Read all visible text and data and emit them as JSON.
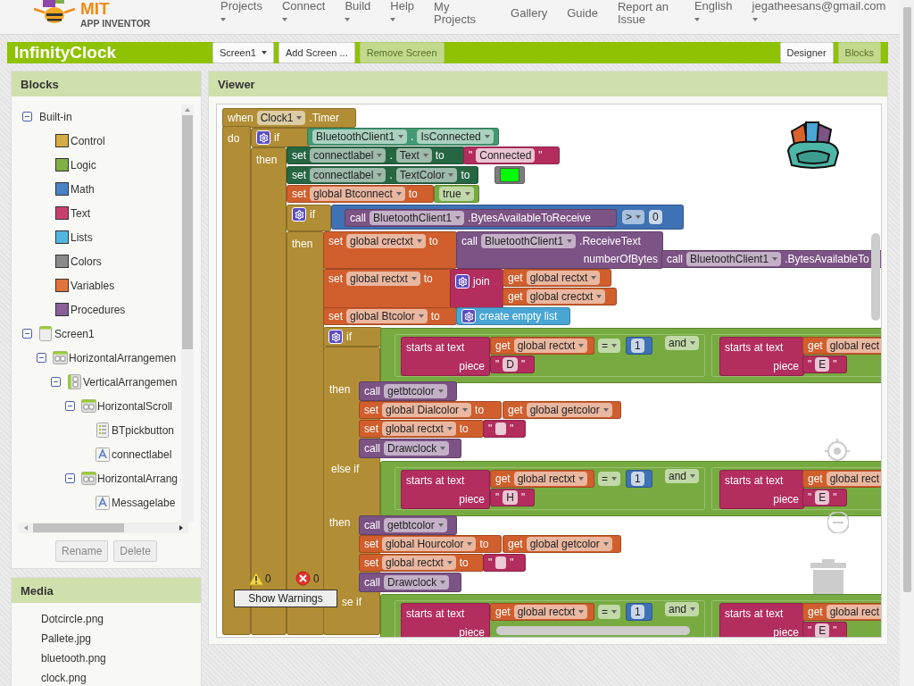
{
  "app": {
    "logo": {
      "title": "MIT",
      "subtitle": "APP INVENTOR"
    },
    "nav": [
      {
        "label": "Projects",
        "menu": true
      },
      {
        "label": "Connect",
        "menu": true
      },
      {
        "label": "Build",
        "menu": true
      },
      {
        "label": "Help",
        "menu": true
      },
      {
        "label": "My Projects",
        "menu": false
      },
      {
        "label": "Gallery",
        "menu": false
      },
      {
        "label": "Guide",
        "menu": false
      },
      {
        "label": "Report an Issue",
        "menu": false
      },
      {
        "label": "English",
        "menu": true
      },
      {
        "label": "jegatheesans@gmail.com",
        "menu": true
      }
    ]
  },
  "toolbar": {
    "project": "InfinityClock",
    "screen": "Screen1",
    "actions": [
      {
        "label": "Add Screen ...",
        "disabled": false
      },
      {
        "label": "Remove Screen",
        "disabled": true
      }
    ],
    "views": [
      {
        "label": "Designer",
        "selected": false
      },
      {
        "label": "Blocks",
        "selected": true
      }
    ]
  },
  "blocks_panel": {
    "title": "Blocks",
    "tree": [
      {
        "label": "Built-in",
        "kind": "group",
        "expanded": true,
        "children": [
          {
            "label": "Control",
            "kind": "category",
            "color": "#d6ac45"
          },
          {
            "label": "Logic",
            "kind": "category",
            "color": "#7fb045"
          },
          {
            "label": "Math",
            "kind": "category",
            "color": "#4a80c4"
          },
          {
            "label": "Text",
            "kind": "category",
            "color": "#c8416e"
          },
          {
            "label": "Lists",
            "kind": "category",
            "color": "#52b7e0"
          },
          {
            "label": "Colors",
            "kind": "category",
            "color": "#8a8a8a"
          },
          {
            "label": "Variables",
            "kind": "category",
            "color": "#e0743a"
          },
          {
            "label": "Procedures",
            "kind": "category",
            "color": "#8a5e98"
          }
        ]
      },
      {
        "label": "Screen1",
        "kind": "screen",
        "expanded": true,
        "children": [
          {
            "label": "HorizontalArrangemen",
            "kind": "arrangement",
            "expanded": true,
            "children": [
              {
                "label": "VerticalArrangemen",
                "kind": "vertical",
                "expanded": true,
                "children": [
                  {
                    "label": "HorizontalScroll",
                    "kind": "arrangement",
                    "expanded": true,
                    "children": [
                      {
                        "label": "BTpickbutton",
                        "kind": "listpicker"
                      },
                      {
                        "label": "connectlabel",
                        "kind": "label"
                      }
                    ]
                  },
                  {
                    "label": "HorizontalArrang",
                    "kind": "arrangement",
                    "expanded": true,
                    "children": [
                      {
                        "label": "Messagelabe",
                        "kind": "label"
                      }
                    ]
                  }
                ]
              }
            ]
          }
        ]
      }
    ],
    "buttons": [
      {
        "label": "Rename",
        "disabled": true
      },
      {
        "label": "Delete",
        "disabled": true
      }
    ]
  },
  "media": {
    "title": "Media",
    "files": [
      "Dotcircle.png",
      "Pallete.jpg",
      "bluetooth.png",
      "clock.png"
    ]
  },
  "viewer": {
    "title": "Viewer",
    "blocks": [
      {
        "kind": "block",
        "color": "#b18e35",
        "lines": [
          [
            {
              "kind": "label",
              "text": "when"
            },
            {
              "kind": "dropdown",
              "text": "Clock1"
            },
            {
              "kind": "label",
              "text": ".Timer"
            }
          ]
        ]
      },
      {
        "kind": "block",
        "color": "#b18e35",
        "lines": [
          [
            {
              "kind": "label",
              "text": "do"
            }
          ]
        ]
      },
      {
        "kind": "block",
        "color": "#b18e35",
        "lines": [
          [
            {
              "kind": "gear"
            },
            {
              "kind": "label",
              "text": "if"
            }
          ]
        ]
      },
      {
        "kind": "block",
        "color": "#b18e35",
        "lines": [
          [
            {
              "kind": "label",
              "text": "then"
            }
          ]
        ]
      },
      {
        "kind": "block",
        "color": "#439a72",
        "lines": [
          [
            {
              "kind": "dropdown",
              "text": "BluetoothClient1"
            },
            {
              "kind": "label",
              "text": "."
            },
            {
              "kind": "dropdown",
              "text": "IsConnected"
            }
          ]
        ]
      },
      {
        "kind": "block",
        "color": "#266643",
        "lines": [
          [
            {
              "kind": "label",
              "text": "set"
            },
            {
              "kind": "dropdown",
              "text": "connectlabel"
            },
            {
              "kind": "label",
              "text": "."
            },
            {
              "kind": "dropdown",
              "text": "Text"
            },
            {
              "kind": "label",
              "text": "to"
            }
          ]
        ]
      },
      {
        "kind": "block",
        "color": "#b32d5e",
        "lines": [
          [
            {
              "kind": "label",
              "text": "\""
            },
            {
              "kind": "value",
              "text": "Connected"
            },
            {
              "kind": "label",
              "text": "\""
            }
          ]
        ]
      },
      {
        "kind": "block",
        "color": "#266643",
        "lines": [
          [
            {
              "kind": "label",
              "text": "set"
            },
            {
              "kind": "dropdown",
              "text": "connectlabel"
            },
            {
              "kind": "label",
              "text": "."
            },
            {
              "kind": "dropdown",
              "text": "TextColor"
            },
            {
              "kind": "label",
              "text": "to"
            }
          ]
        ]
      },
      {
        "kind": "block",
        "color": "#7d7d7d",
        "lines": [
          [
            {
              "kind": "swatch",
              "color": "#00ff00"
            }
          ]
        ]
      },
      {
        "kind": "block",
        "color": "#d05f2d",
        "lines": [
          [
            {
              "kind": "label",
              "text": "set"
            },
            {
              "kind": "dropdown",
              "text": "global Btconnect"
            },
            {
              "kind": "label",
              "text": "to"
            }
          ]
        ]
      },
      {
        "kind": "block",
        "color": "#77ab41",
        "lines": [
          [
            {
              "kind": "dropdown",
              "text": "true"
            }
          ]
        ]
      },
      {
        "kind": "block",
        "color": "#b18e35",
        "lines": [
          [
            {
              "kind": "gear"
            },
            {
              "kind": "label",
              "text": "if"
            }
          ]
        ]
      },
      {
        "kind": "block",
        "color": "#b18e35",
        "lines": [
          [
            {
              "kind": "label",
              "text": "then"
            }
          ]
        ]
      },
      {
        "kind": "block",
        "color": "#3f71b5"
      },
      {
        "kind": "block",
        "color": "#7c5385",
        "lines": [
          [
            {
              "kind": "label",
              "text": "call"
            },
            {
              "kind": "dropdown",
              "text": "BluetoothClient1"
            },
            {
              "kind": "label",
              "text": ".BytesAvailableToReceive"
            }
          ]
        ]
      },
      {
        "kind": "fields",
        "lines": [
          [
            {
              "kind": "dropdown",
              "text": ">"
            },
            {
              "kind": "value",
              "text": "0"
            }
          ]
        ]
      },
      {
        "kind": "block",
        "color": "#d05f2d",
        "lines": [
          [
            {
              "kind": "label",
              "text": "set"
            },
            {
              "kind": "dropdown",
              "text": "global crectxt"
            },
            {
              "kind": "label",
              "text": "to"
            }
          ]
        ]
      },
      {
        "kind": "block",
        "color": "#7c5385",
        "lines": [
          [
            {
              "kind": "label",
              "text": "call"
            },
            {
              "kind": "dropdown",
              "text": "BluetoothClient1"
            },
            {
              "kind": "label",
              "text": ".ReceiveText"
            }
          ],
          [
            {
              "kind": "label",
              "text": "numberOfBytes"
            }
          ]
        ]
      },
      {
        "kind": "block",
        "color": "#7c5385",
        "lines": [
          [
            {
              "kind": "label",
              "text": "call"
            },
            {
              "kind": "dropdown",
              "text": "BluetoothClient1"
            },
            {
              "kind": "label",
              "text": ".BytesAvailableTo"
            }
          ]
        ]
      },
      {
        "kind": "block",
        "color": "#d05f2d",
        "lines": [
          [
            {
              "kind": "label",
              "text": "set"
            },
            {
              "kind": "dropdown",
              "text": "global rectxt"
            },
            {
              "kind": "label",
              "text": "to"
            }
          ]
        ]
      },
      {
        "kind": "block",
        "color": "#b32d5e",
        "lines": [
          [
            {
              "kind": "gear"
            },
            {
              "kind": "label",
              "text": "join"
            }
          ]
        ]
      },
      {
        "kind": "block",
        "color": "#d05f2d",
        "lines": [
          [
            {
              "kind": "label",
              "text": "get"
            },
            {
              "kind": "dropdown",
              "text": "global rectxt"
            }
          ]
        ]
      },
      {
        "kind": "block",
        "color": "#d05f2d",
        "lines": [
          [
            {
              "kind": "label",
              "text": "get"
            },
            {
              "kind": "dropdown",
              "text": "global crectxt"
            }
          ]
        ]
      },
      {
        "kind": "block",
        "color": "#d05f2d",
        "lines": [
          [
            {
              "kind": "label",
              "text": "set"
            },
            {
              "kind": "dropdown",
              "text": "global Btcolor"
            },
            {
              "kind": "label",
              "text": "to"
            }
          ]
        ]
      },
      {
        "kind": "block",
        "color": "#49a6d4",
        "lines": [
          [
            {
              "kind": "gear"
            },
            {
              "kind": "label",
              "text": "create empty list"
            }
          ]
        ]
      },
      {
        "kind": "block",
        "color": "#b18e35",
        "lines": [
          [
            {
              "kind": "gear"
            },
            {
              "kind": "label",
              "text": "if"
            }
          ]
        ]
      },
      {
        "kind": "block",
        "color": "#b18e35"
      },
      {
        "kind": "label",
        "text": "then"
      },
      {
        "kind": "label",
        "text": "else if"
      },
      {
        "kind": "label",
        "text": "then"
      },
      {
        "kind": "label",
        "text": "se if"
      },
      {
        "kind": "block",
        "color": "#77ab41"
      },
      {
        "kind": "socket",
        "color": "#77ab41"
      },
      {
        "kind": "block",
        "color": "#b32d5e",
        "lines": [
          [
            {
              "kind": "label",
              "text": "starts at text"
            }
          ],
          [
            {
              "kind": "label",
              "text": "piece"
            }
          ]
        ]
      },
      {
        "kind": "block",
        "color": "#d05f2d",
        "lines": [
          [
            {
              "kind": "label",
              "text": "get"
            },
            {
              "kind": "dropdown",
              "text": "global rectxt"
            }
          ]
        ]
      },
      {
        "kind": "fields",
        "lines": [
          [
            {
              "kind": "dropdown",
              "text": "="
            }
          ]
        ]
      },
      {
        "kind": "block",
        "color": "#3f71b5",
        "lines": [
          [
            {
              "kind": "value",
              "text": "1"
            }
          ]
        ]
      },
      {
        "kind": "block",
        "color": "#b32d5e",
        "lines": [
          [
            {
              "kind": "label",
              "text": "\""
            },
            {
              "kind": "value",
              "text": "D"
            },
            {
              "kind": "label",
              "text": "\""
            }
          ]
        ]
      },
      {
        "kind": "fields",
        "lines": [
          [
            {
              "kind": "dropdown",
              "text": "and"
            }
          ]
        ]
      },
      {
        "kind": "socket",
        "color": "#77ab41"
      },
      {
        "kind": "block",
        "color": "#b32d5e",
        "lines": [
          [
            {
              "kind": "label",
              "text": "starts at text"
            }
          ],
          [
            {
              "kind": "label",
              "text": "piece"
            }
          ]
        ]
      },
      {
        "kind": "block",
        "color": "#d05f2d",
        "lines": [
          [
            {
              "kind": "label",
              "text": "get"
            },
            {
              "kind": "dropdown",
              "text": "global rect"
            }
          ]
        ]
      },
      {
        "kind": "block",
        "color": "#b32d5e",
        "lines": [
          [
            {
              "kind": "label",
              "text": "\""
            },
            {
              "kind": "value",
              "text": "E"
            },
            {
              "kind": "label",
              "text": "\""
            }
          ]
        ]
      },
      {
        "kind": "block",
        "color": "#7c5385",
        "lines": [
          [
            {
              "kind": "label",
              "text": "call"
            },
            {
              "kind": "dropdown",
              "text": "getbtcolor"
            }
          ]
        ]
      },
      {
        "kind": "block",
        "color": "#d05f2d",
        "lines": [
          [
            {
              "kind": "label",
              "text": "set"
            },
            {
              "kind": "dropdown",
              "text": "global Dialcolor"
            },
            {
              "kind": "label",
              "text": "to"
            }
          ]
        ]
      },
      {
        "kind": "block",
        "color": "#d05f2d",
        "lines": [
          [
            {
              "kind": "label",
              "text": "get"
            },
            {
              "kind": "dropdown",
              "text": "global getcolor"
            }
          ]
        ]
      },
      {
        "kind": "block",
        "color": "#d05f2d",
        "lines": [
          [
            {
              "kind": "label",
              "text": "set"
            },
            {
              "kind": "dropdown",
              "text": "global rectxt"
            },
            {
              "kind": "label",
              "text": "to"
            }
          ]
        ]
      },
      {
        "kind": "block",
        "color": "#b32d5e",
        "lines": [
          [
            {
              "kind": "label",
              "text": "\""
            },
            {
              "kind": "blank"
            },
            {
              "kind": "label",
              "text": "\""
            }
          ]
        ]
      },
      {
        "kind": "block",
        "color": "#7c5385",
        "lines": [
          [
            {
              "kind": "label",
              "text": "call"
            },
            {
              "kind": "dropdown",
              "text": "Drawclock"
            }
          ]
        ]
      },
      {
        "kind": "block",
        "color": "#77ab41"
      },
      {
        "kind": "socket",
        "color": "#77ab41"
      },
      {
        "kind": "block",
        "color": "#b32d5e",
        "lines": [
          [
            {
              "kind": "label",
              "text": "starts at text"
            }
          ],
          [
            {
              "kind": "label",
              "text": "piece"
            }
          ]
        ]
      },
      {
        "kind": "block",
        "color": "#d05f2d",
        "lines": [
          [
            {
              "kind": "label",
              "text": "get"
            },
            {
              "kind": "dropdown",
              "text": "global rectxt"
            }
          ]
        ]
      },
      {
        "kind": "fields",
        "lines": [
          [
            {
              "kind": "dropdown",
              "text": "="
            }
          ]
        ]
      },
      {
        "kind": "block",
        "color": "#3f71b5",
        "lines": [
          [
            {
              "kind": "value",
              "text": "1"
            }
          ]
        ]
      },
      {
        "kind": "block",
        "color": "#b32d5e",
        "lines": [
          [
            {
              "kind": "label",
              "text": "\""
            },
            {
              "kind": "value",
              "text": "H"
            },
            {
              "kind": "label",
              "text": "\""
            }
          ]
        ]
      },
      {
        "kind": "fields",
        "lines": [
          [
            {
              "kind": "dropdown",
              "text": "and"
            }
          ]
        ]
      },
      {
        "kind": "socket",
        "color": "#77ab41"
      },
      {
        "kind": "block",
        "color": "#b32d5e",
        "lines": [
          [
            {
              "kind": "label",
              "text": "starts at text"
            }
          ],
          [
            {
              "kind": "label",
              "text": "piece"
            }
          ]
        ]
      },
      {
        "kind": "block",
        "color": "#d05f2d",
        "lines": [
          [
            {
              "kind": "label",
              "text": "get"
            },
            {
              "kind": "dropdown",
              "text": "global rect"
            }
          ]
        ]
      },
      {
        "kind": "block",
        "color": "#b32d5e",
        "lines": [
          [
            {
              "kind": "label",
              "text": "\""
            },
            {
              "kind": "value",
              "text": "E"
            },
            {
              "kind": "label",
              "text": "\""
            }
          ]
        ]
      },
      {
        "kind": "block",
        "color": "#7c5385",
        "lines": [
          [
            {
              "kind": "label",
              "text": "call"
            },
            {
              "kind": "dropdown",
              "text": "getbtcolor"
            }
          ]
        ]
      },
      {
        "kind": "block",
        "color": "#d05f2d",
        "lines": [
          [
            {
              "kind": "label",
              "text": "set"
            },
            {
              "kind": "dropdown",
              "text": "global Hourcolor"
            },
            {
              "kind": "label",
              "text": "to"
            }
          ]
        ]
      },
      {
        "kind": "block",
        "color": "#d05f2d",
        "lines": [
          [
            {
              "kind": "label",
              "text": "get"
            },
            {
              "kind": "dropdown",
              "text": "global getcolor"
            }
          ]
        ]
      },
      {
        "kind": "block",
        "color": "#d05f2d",
        "lines": [
          [
            {
              "kind": "label",
              "text": "set"
            },
            {
              "kind": "dropdown",
              "text": "global rectxt"
            },
            {
              "kind": "label",
              "text": "to"
            }
          ]
        ]
      },
      {
        "kind": "block",
        "color": "#b32d5e",
        "lines": [
          [
            {
              "kind": "label",
              "text": "\""
            },
            {
              "kind": "blank"
            },
            {
              "kind": "label",
              "text": "\""
            }
          ]
        ]
      },
      {
        "kind": "block",
        "color": "#7c5385",
        "lines": [
          [
            {
              "kind": "label",
              "text": "call"
            },
            {
              "kind": "dropdown",
              "text": "Drawclock"
            }
          ]
        ]
      },
      {
        "kind": "block",
        "color": "#77ab41"
      },
      {
        "kind": "socket",
        "color": "#77ab41"
      },
      {
        "kind": "block",
        "color": "#b32d5e",
        "lines": [
          [
            {
              "kind": "label",
              "text": "starts at text"
            }
          ],
          [
            {
              "kind": "label",
              "text": "piece"
            }
          ]
        ]
      },
      {
        "kind": "block",
        "color": "#d05f2d",
        "lines": [
          [
            {
              "kind": "label",
              "text": "get"
            },
            {
              "kind": "dropdown",
              "text": "global rectxt"
            }
          ]
        ]
      },
      {
        "kind": "fields",
        "lines": [
          [
            {
              "kind": "dropdown",
              "text": "="
            }
          ]
        ]
      },
      {
        "kind": "block",
        "color": "#3f71b5",
        "lines": [
          [
            {
              "kind": "value",
              "text": "1"
            }
          ]
        ]
      },
      {
        "kind": "fields",
        "lines": [
          [
            {
              "kind": "dropdown",
              "text": "and"
            }
          ]
        ]
      },
      {
        "kind": "socket",
        "color": "#77ab41"
      },
      {
        "kind": "block",
        "color": "#b32d5e",
        "lines": [
          [
            {
              "kind": "label",
              "text": "starts at text"
            }
          ],
          [
            {
              "kind": "label",
              "text": "piece"
            }
          ]
        ]
      },
      {
        "kind": "block",
        "color": "#d05f2d",
        "lines": [
          [
            {
              "kind": "label",
              "text": "get"
            },
            {
              "kind": "dropdown",
              "text": "global rect"
            }
          ]
        ]
      },
      {
        "kind": "block",
        "color": "#b32d5e",
        "lines": [
          [
            {
              "kind": "label",
              "text": "\""
            },
            {
              "kind": "value",
              "text": "E"
            },
            {
              "kind": "label",
              "text": "\""
            }
          ]
        ]
      }
    ],
    "warnings": {
      "warning_count": "0",
      "error_count": "0",
      "button": "Show Warnings"
    }
  }
}
